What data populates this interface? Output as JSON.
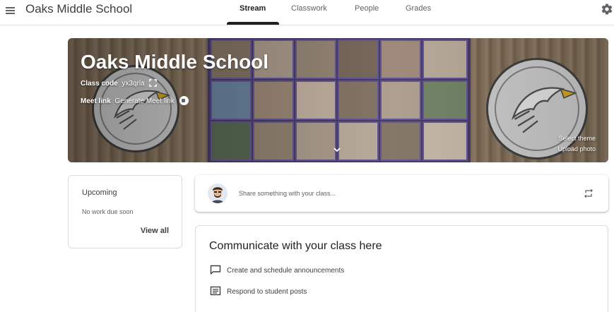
{
  "header": {
    "menu_icon": "hamburger-menu-icon",
    "title": "Oaks Middle School",
    "tabs": [
      {
        "label": "Stream",
        "active": true
      },
      {
        "label": "Classwork",
        "active": false
      },
      {
        "label": "People",
        "active": false
      },
      {
        "label": "Grades",
        "active": false
      }
    ],
    "settings_icon": "gear-icon"
  },
  "banner": {
    "class_name": "Oaks Middle School",
    "class_code_label": "Class code",
    "class_code_value": "yx3qrla",
    "meet_label": "Meet link",
    "meet_action": "Generate Meet link",
    "select_theme": "Select theme",
    "upload_photo": "Upload photo"
  },
  "upcoming": {
    "title": "Upcoming",
    "empty_text": "No work due soon",
    "view_all": "View all"
  },
  "share": {
    "placeholder": "Share something with your class..."
  },
  "communicate": {
    "title": "Communicate with your class here",
    "items": [
      {
        "icon": "chat-bubble-icon",
        "label": "Create and schedule announcements"
      },
      {
        "icon": "message-list-icon",
        "label": "Respond to student posts"
      }
    ]
  },
  "colors": {
    "text_primary": "#1f1f1f",
    "text_secondary": "#5f6368",
    "border": "#dadce0",
    "active_tab": "#1f1f1f"
  }
}
